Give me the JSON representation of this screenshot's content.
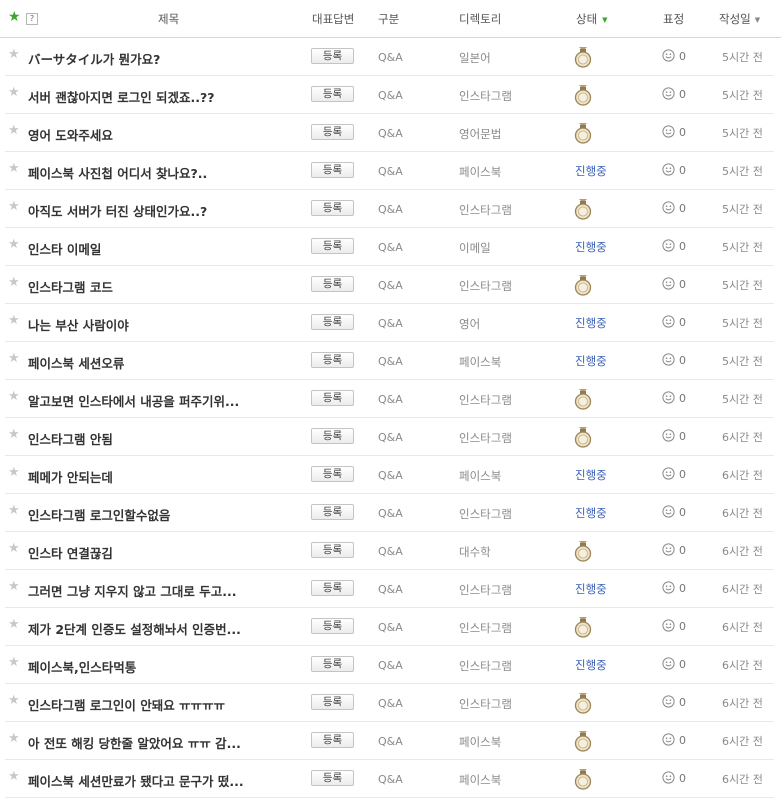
{
  "header": {
    "star_icon": "star-icon",
    "help_label": "?",
    "title_label": "제목",
    "answer_label": "대표답변",
    "type_label": "구분",
    "directory_label": "디렉토리",
    "status_label": "상태",
    "expression_label": "표정",
    "date_label": "작성일",
    "accent_color": "#3aa72c"
  },
  "rows": [
    {
      "title": "バーサタイル가 뭔가요?",
      "button": "등록",
      "type": "Q&A",
      "directory": "일본어",
      "status": "medal",
      "status_text": "",
      "expression": "0",
      "date": "5시간 전"
    },
    {
      "title": "서버 괜찮아지면 로그인 되겠죠..??",
      "button": "등록",
      "type": "Q&A",
      "directory": "인스타그램",
      "status": "medal",
      "status_text": "",
      "expression": "0",
      "date": "5시간 전"
    },
    {
      "title": "영어 도와주세요",
      "button": "등록",
      "type": "Q&A",
      "directory": "영어문법",
      "status": "medal",
      "status_text": "",
      "expression": "0",
      "date": "5시간 전"
    },
    {
      "title": "페이스북 사진첩 어디서 찾나요?..",
      "button": "등록",
      "type": "Q&A",
      "directory": "페이스북",
      "status": "text",
      "status_text": "진행중",
      "expression": "0",
      "date": "5시간 전"
    },
    {
      "title": "아직도 서버가 터진 상태인가요..?",
      "button": "등록",
      "type": "Q&A",
      "directory": "인스타그램",
      "status": "medal",
      "status_text": "",
      "expression": "0",
      "date": "5시간 전"
    },
    {
      "title": "인스타 이메일",
      "button": "등록",
      "type": "Q&A",
      "directory": "이메일",
      "status": "text",
      "status_text": "진행중",
      "expression": "0",
      "date": "5시간 전"
    },
    {
      "title": "인스타그램 코드",
      "button": "등록",
      "type": "Q&A",
      "directory": "인스타그램",
      "status": "medal",
      "status_text": "",
      "expression": "0",
      "date": "5시간 전"
    },
    {
      "title": "나는 부산 사람이야",
      "button": "등록",
      "type": "Q&A",
      "directory": "영어",
      "status": "text",
      "status_text": "진행중",
      "expression": "0",
      "date": "5시간 전"
    },
    {
      "title": "페이스북 세션오류",
      "button": "등록",
      "type": "Q&A",
      "directory": "페이스북",
      "status": "text",
      "status_text": "진행중",
      "expression": "0",
      "date": "5시간 전"
    },
    {
      "title": "알고보면 인스타에서 내공을 퍼주기위...",
      "button": "등록",
      "type": "Q&A",
      "directory": "인스타그램",
      "status": "medal",
      "status_text": "",
      "expression": "0",
      "date": "5시간 전"
    },
    {
      "title": "인스타그램 안됨",
      "button": "등록",
      "type": "Q&A",
      "directory": "인스타그램",
      "status": "medal",
      "status_text": "",
      "expression": "0",
      "date": "6시간 전"
    },
    {
      "title": "페메가 안되는데",
      "button": "등록",
      "type": "Q&A",
      "directory": "페이스북",
      "status": "text",
      "status_text": "진행중",
      "expression": "0",
      "date": "6시간 전"
    },
    {
      "title": "인스타그램 로그인할수없음",
      "button": "등록",
      "type": "Q&A",
      "directory": "인스타그램",
      "status": "text",
      "status_text": "진행중",
      "expression": "0",
      "date": "6시간 전"
    },
    {
      "title": "인스타 연결끊김",
      "button": "등록",
      "type": "Q&A",
      "directory": "대수학",
      "status": "medal",
      "status_text": "",
      "expression": "0",
      "date": "6시간 전"
    },
    {
      "title": "그러면 그냥 지우지 않고 그대로 두고...",
      "button": "등록",
      "type": "Q&A",
      "directory": "인스타그램",
      "status": "text",
      "status_text": "진행중",
      "expression": "0",
      "date": "6시간 전"
    },
    {
      "title": "제가 2단계 인증도 설정해놔서 인증번...",
      "button": "등록",
      "type": "Q&A",
      "directory": "인스타그램",
      "status": "medal",
      "status_text": "",
      "expression": "0",
      "date": "6시간 전"
    },
    {
      "title": "페이스북,인스타먹통",
      "button": "등록",
      "type": "Q&A",
      "directory": "인스타그램",
      "status": "text",
      "status_text": "진행중",
      "expression": "0",
      "date": "6시간 전"
    },
    {
      "title": "인스타그램 로그인이 안돼요 ㅠㅠㅠㅠ",
      "button": "등록",
      "type": "Q&A",
      "directory": "인스타그램",
      "status": "medal",
      "status_text": "",
      "expression": "0",
      "date": "6시간 전"
    },
    {
      "title": "아 전또 해킹 당한줄 알았어요 ㅠㅠ 감...",
      "button": "등록",
      "type": "Q&A",
      "directory": "페이스북",
      "status": "medal",
      "status_text": "",
      "expression": "0",
      "date": "6시간 전"
    },
    {
      "title": "페이스북 세션만료가 됐다고 문구가 떴...",
      "button": "등록",
      "type": "Q&A",
      "directory": "페이스북",
      "status": "medal",
      "status_text": "",
      "expression": "0",
      "date": "6시간 전"
    }
  ]
}
